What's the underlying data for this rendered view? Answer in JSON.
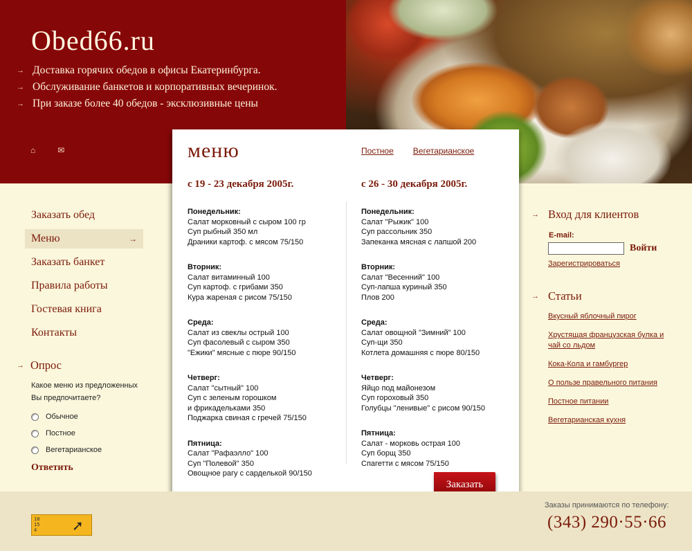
{
  "header": {
    "logo": "Obed66.ru",
    "taglines": [
      "Доставка горячих обедов в офисы Екатеринбурга.",
      "Обслуживание банкетов и корпоративных вечеринок.",
      "При заказе более 40 обедов - эксклюзивные цены"
    ],
    "icons": [
      "home-icon",
      "mail-icon"
    ]
  },
  "nav": {
    "items": [
      {
        "label": "Заказать обед",
        "active": false
      },
      {
        "label": "Меню",
        "active": true
      },
      {
        "label": "Заказать банкет",
        "active": false
      },
      {
        "label": "Правила работы",
        "active": false
      },
      {
        "label": "Гостевая книга",
        "active": false
      },
      {
        "label": "Контакты",
        "active": false
      }
    ]
  },
  "poll": {
    "title": "Опрос",
    "question_line1": "Какое меню из предложенных",
    "question_line2": "Вы предпочитаете?",
    "options": [
      "Обычное",
      "Постное",
      "Вегетарианское"
    ],
    "submit": "Ответить"
  },
  "menu": {
    "title": "меню",
    "links": [
      "Постное",
      "Вегетарианское"
    ],
    "weeks": [
      {
        "title": "с 19 - 23 декабря 2005г.",
        "days": [
          {
            "name": "Понедельник:",
            "items": [
              "Салат морковный с сыром 100 гр",
              "Суп рыбный 350 мл",
              "Драники картоф. с мясом 75/150"
            ]
          },
          {
            "name": "Вторник:",
            "items": [
              "Салат витаминный 100",
              "Суп картоф. с грибами 350",
              "Кура жареная с рисом 75/150"
            ]
          },
          {
            "name": "Среда:",
            "items": [
              "Салат из свеклы острый 100",
              "Суп фасолевый с сыром 350",
              "\"Ежики\" мясные с пюре 90/150"
            ]
          },
          {
            "name": "Четверг:",
            "items": [
              "Салат \"сытный\" 100",
              "Суп с зеленым горошком",
              "и фрикадельками 350",
              "Поджарка свиная с гречей 75/150"
            ]
          },
          {
            "name": "Пятница:",
            "items": [
              "Салат \"Рафаэлло\" 100",
              "Суп \"Полевой\" 350",
              "Овощное рагу с сарделькой 90/150"
            ]
          }
        ]
      },
      {
        "title": "с 26 - 30 декабря 2005г.",
        "days": [
          {
            "name": "Понедельник:",
            "items": [
              "Салат \"Рыжик\" 100",
              "Суп рассольник 350",
              "Запеканка мясная с лапшой 200"
            ]
          },
          {
            "name": "Вторник:",
            "items": [
              "Салат \"Весенний\" 100",
              "Суп-лапша куриный 350",
              "Плов 200"
            ]
          },
          {
            "name": "Среда:",
            "items": [
              "Салат овощной \"Зимний\" 100",
              "Суп-щи 350",
              "Котлета домашняя с пюре 80/150"
            ]
          },
          {
            "name": "Четверг:",
            "items": [
              "Яйцо под майонезом",
              "Суп гороховый 350",
              "Голубцы \"ленивые\" с рисом 90/150"
            ]
          },
          {
            "name": "Пятница:",
            "items": [
              "Салат - морковь острая 100",
              "Суп борщ 350",
              "Спагетти с мясом 75/150"
            ]
          }
        ]
      }
    ],
    "order_button": "Заказать"
  },
  "login": {
    "title": "Вход для клиентов",
    "email_label": "E-mail:",
    "email_value": "",
    "submit": "Войти",
    "register": "Зарегистрироваться"
  },
  "articles": {
    "title": "Статьи",
    "items": [
      "Вкусный яблочный пирог",
      "Хрустящая французская булка и чай со льдом",
      "Кока-Кола и гамбургер",
      "О пользе правельного питания",
      "Постное питании",
      "Вегетарианская кухня"
    ]
  },
  "footer": {
    "phone_label": "Заказы принимаются по телефону:",
    "phone": "(343) 290·55·66",
    "counter_digits": [
      "18",
      "15",
      "4"
    ]
  },
  "colors": {
    "brand": "#860708",
    "accent": "#7a1a0a",
    "cream": "#fbf7dc"
  }
}
